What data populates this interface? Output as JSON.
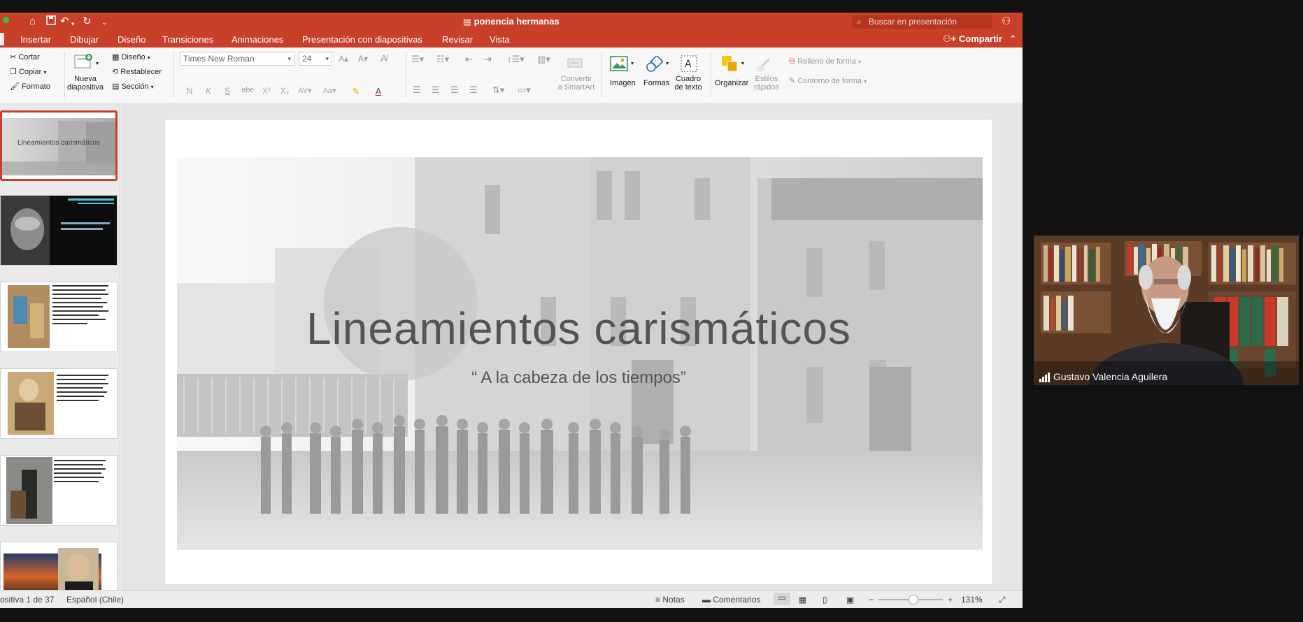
{
  "titlebar": {
    "doc_title": "ponencia hermanas",
    "search_placeholder": "Buscar en presentación"
  },
  "tabs": [
    "Insertar",
    "Dibujar",
    "Diseño",
    "Transiciones",
    "Animaciones",
    "Presentación con diapositivas",
    "Revisar",
    "Vista"
  ],
  "share_label": "Compartir",
  "ribbon": {
    "clipboard": {
      "cut": "Cortar",
      "copy": "Copiar",
      "format": "Formato"
    },
    "new_slide": [
      "Nueva",
      "diapositiva"
    ],
    "slides": {
      "layout": "Diseño",
      "reset": "Restablecer",
      "section": "Sección"
    },
    "font_name": "Times New Roman",
    "font_size": "24",
    "format_buttons": [
      "N",
      "K",
      "S",
      "abc",
      "X²",
      "X₂"
    ],
    "convert_smartart": [
      "Convertir",
      "a SmartArt"
    ],
    "image": "Imagen",
    "shapes": "Formas",
    "textbox": [
      "Cuadro",
      "de texto"
    ],
    "arrange": "Organizar",
    "quick_styles": [
      "Estilos",
      "rápidos"
    ],
    "shape_fill": "Relleno de forma",
    "shape_outline": "Contorno de forma"
  },
  "thumbnails": {
    "slide1_title": "Lineamientos carismáticos"
  },
  "slide": {
    "title": "Lineamientos carismáticos",
    "subtitle": "“ A la cabeza de los tiempos”"
  },
  "statusbar": {
    "slide_position": "ositiva 1 de 37",
    "language": "Español (Chile)",
    "notes": "Notas",
    "comments": "Comentarios",
    "zoom": "131%"
  },
  "video": {
    "participant_name": "Gustavo Valencia Aguilera"
  },
  "colors": {
    "accent": "#c8402a"
  }
}
